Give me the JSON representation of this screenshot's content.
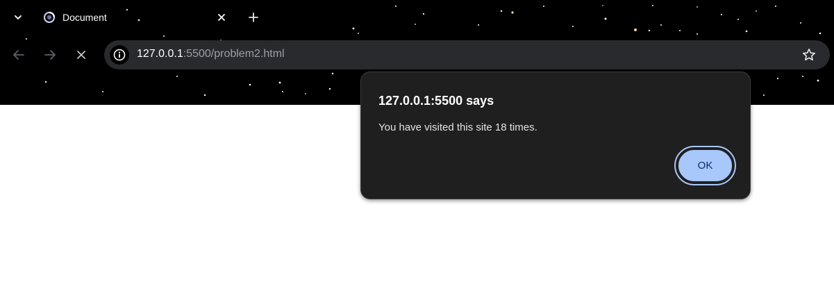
{
  "tab": {
    "title": "Document",
    "search_icon": "chevron-down-icon",
    "favicon": "loading-spinner-icon",
    "close_icon": "close-icon",
    "new_tab_icon": "plus-icon"
  },
  "toolbar": {
    "back_icon": "arrow-left-icon",
    "forward_icon": "arrow-right-icon",
    "stop_icon": "close-icon",
    "site_info_icon": "info-icon",
    "bookmark_icon": "star-icon"
  },
  "omnibox": {
    "url_host": "127.0.0.1",
    "url_rest": ":5500/problem2.html"
  },
  "dialog": {
    "title": "127.0.0.1:5500 says",
    "message": "You have visited this site 18 times.",
    "ok_label": "OK"
  },
  "colors": {
    "chrome_bg": "#000000",
    "omnibox_bg": "#282a2d",
    "dialog_bg": "#1f1f1f",
    "ok_button_bg": "#a8c7fa",
    "ok_button_text": "#062e6f",
    "page_bg": "#ffffff"
  }
}
